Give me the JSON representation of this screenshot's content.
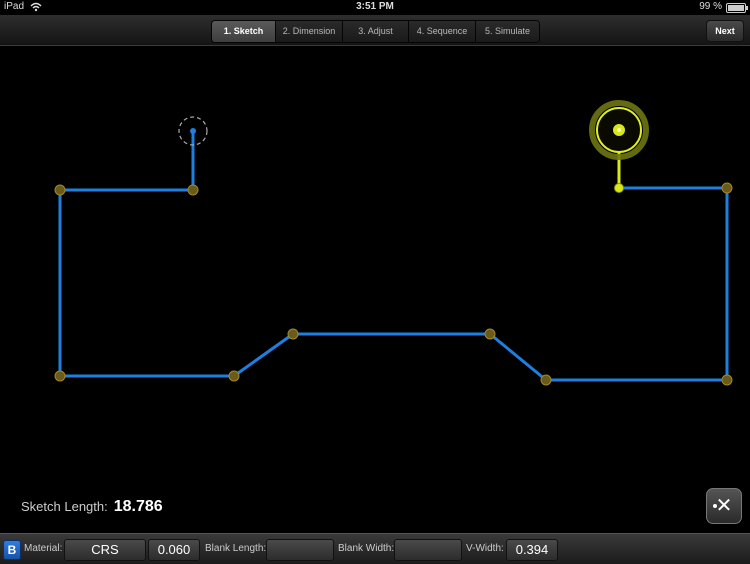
{
  "status": {
    "carrier": "iPad",
    "time": "3:51 PM",
    "battery": "99 %",
    "battery_level": 0.99
  },
  "toolbar": {
    "tabs": [
      {
        "label": "1. Sketch",
        "active": true
      },
      {
        "label": "2. Dimension",
        "active": false
      },
      {
        "label": "3. Adjust",
        "active": false
      },
      {
        "label": "4. Sequence",
        "active": false
      },
      {
        "label": "5. Simulate",
        "active": false
      }
    ],
    "next_label": "Next"
  },
  "canvas": {
    "line_color": "#1e7fe0",
    "active_color": "#d9e81a",
    "node_color": "#6b5a1a"
  },
  "sketch": {
    "label": "Sketch Length:",
    "value": "18.786"
  },
  "tool_button": {
    "icon": "trim-tool-icon"
  },
  "bottom": {
    "b_label": "B",
    "material_label": "Material:",
    "material_value": "CRS",
    "thickness_value": "0.060",
    "blank_length_label": "Blank Length:",
    "blank_length_value": "",
    "blank_width_label": "Blank Width:",
    "blank_width_value": "",
    "vwidth_label": "V-Width:",
    "vwidth_value": "0.394"
  }
}
